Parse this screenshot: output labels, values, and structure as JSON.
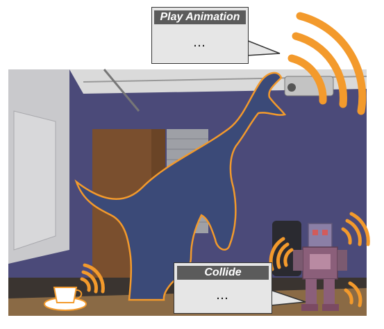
{
  "bubbles": {
    "play_animation": {
      "title": "Play Animation",
      "body": "…"
    },
    "collide": {
      "title": "Collide",
      "body": "…"
    }
  },
  "colors": {
    "wall": "#4b4a79",
    "door": "#7a4f2e",
    "floor": "#3a3430",
    "table": "#8a6a45",
    "accent_orange": "#f39a2c",
    "dino": "#3b4a78",
    "robot": "#8b5f7a"
  },
  "icons": [
    "signal-waves-icon",
    "teacup-icon",
    "robot-icon",
    "dinosaur-figure"
  ]
}
